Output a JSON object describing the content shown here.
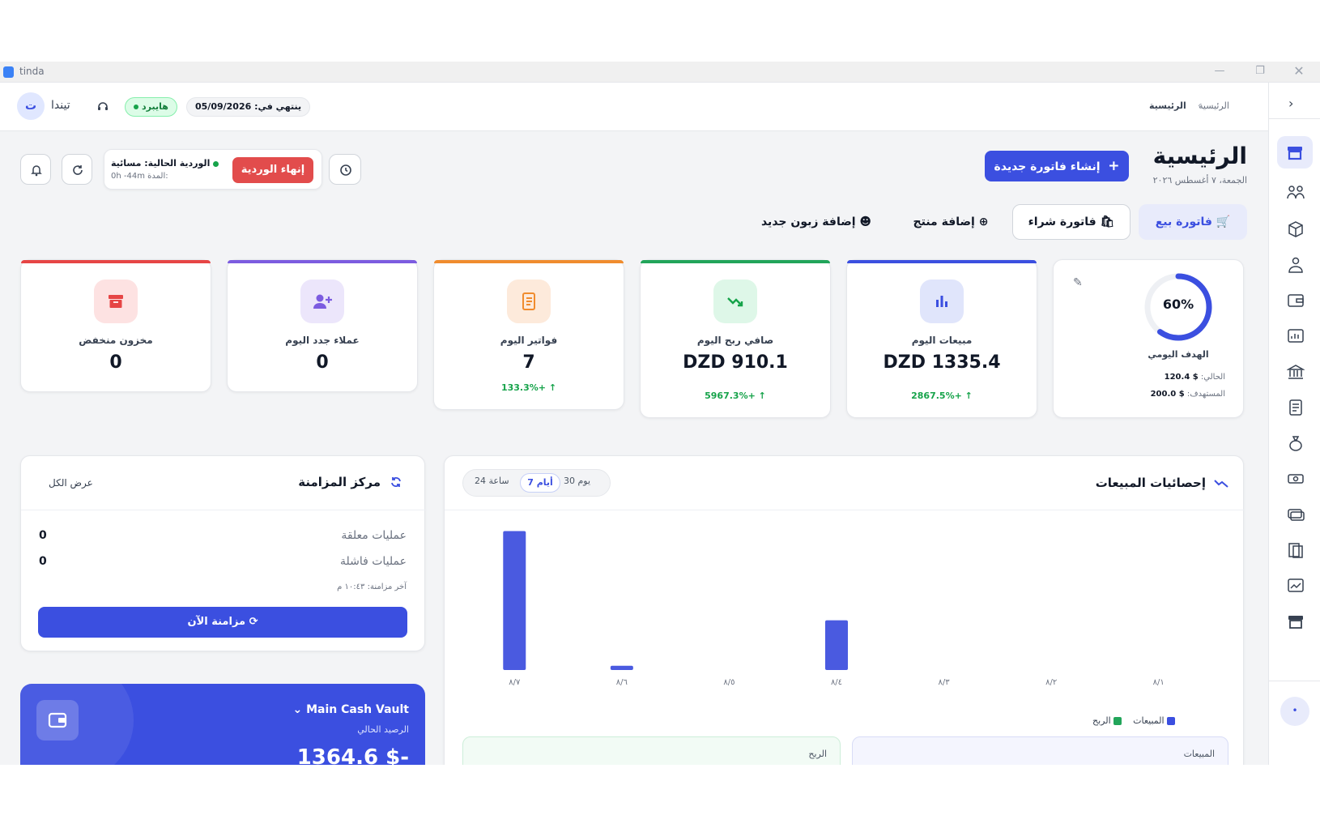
{
  "window": {
    "app_name": "tinda"
  },
  "topbar": {
    "breadcrumb": {
      "root": "الرئيسية",
      "current": "الرئيسية"
    },
    "expiry_label": "ينتهي في:",
    "expiry_date": "05/09/2026",
    "mode_badge": "هايبرد",
    "user_name": "تيندا",
    "user_initial": "ت"
  },
  "header": {
    "title": "الرئيسية",
    "date": "الجمعة، ٧ أغسطس ٢٠٢٦",
    "new_invoice_button": "إنشاء فاتورة جديدة"
  },
  "shift": {
    "end_button": "إنهاء الوردية",
    "label": "الوردية الحالية:",
    "name": "مسائية",
    "duration_label": "المدة:",
    "duration": "0h -44m"
  },
  "quick_actions": [
    "فاتورة بيع",
    "فاتورة شراء",
    "إضافة منتج",
    "إضافة زبون جديد"
  ],
  "goal": {
    "percent": 0.6,
    "percent_label": "60%",
    "label": "الهدف اليومي",
    "current_label": "الحالي:",
    "current_value": "$ 120.4",
    "target_label": "المستهدف:",
    "target_value": "$ 200.0"
  },
  "kpis": [
    {
      "label": "مبيعات اليوم",
      "value": "DZD 1335.4",
      "change": "2867.5%+",
      "color": "#3b4fe0"
    },
    {
      "label": "صافي ربح اليوم",
      "value": "DZD 910.1",
      "change": "5967.3%+",
      "color": "#22a55a"
    },
    {
      "label": "فواتير اليوم",
      "value": "7",
      "change": "133.3%+",
      "color": "#f08c2e"
    },
    {
      "label": "عملاء جدد اليوم",
      "value": "0",
      "color": "#7c5ce0"
    },
    {
      "label": "مخزون منخفض",
      "value": "0",
      "color": "#e64545"
    }
  ],
  "sales_stats": {
    "title": "إحصائيات المبيعات",
    "ranges": [
      "30 يوم",
      "7 أيام",
      "24 ساعة"
    ],
    "active_range": "7 أيام",
    "legend": {
      "sales": "المبيعات",
      "profit": "الربح"
    },
    "bottom_cards": {
      "sales": "المبيعات",
      "profit": "الربح"
    }
  },
  "chart_data": {
    "type": "bar",
    "categories": [
      "٨/١",
      "٨/٢",
      "٨/٣",
      "٨/٤",
      "٨/٥",
      "٨/٦",
      "٨/٧"
    ],
    "series": [
      {
        "name": "المبيعات",
        "values": [
          0,
          0,
          0,
          580,
          0,
          50,
          1620
        ]
      },
      {
        "name": "الربح",
        "values": [
          0,
          0,
          0,
          0,
          0,
          0,
          0
        ]
      }
    ],
    "ylim": [
      0,
      1700
    ],
    "grid": false,
    "legend_position": "bottom-right"
  },
  "sync": {
    "title": "مركز المزامنة",
    "view_all": "عرض الكل",
    "pending_label": "عمليات معلقة",
    "pending_value": "0",
    "failed_label": "عمليات فاشلة",
    "failed_value": "0",
    "last_sync": "آخر مزامنة: ١٠:٤٣ م",
    "sync_button": "مزامنة الآن"
  },
  "vault": {
    "name": "Main Cash Vault",
    "balance_label": "الرصيد الحالي",
    "balance": "-$ 1364.6"
  },
  "colors": {
    "primary": "#3b4fe0",
    "danger": "#e24c4c",
    "success": "#16a34a"
  }
}
